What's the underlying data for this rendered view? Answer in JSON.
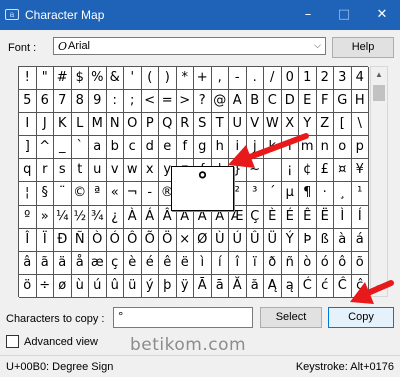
{
  "window": {
    "title": "Character Map",
    "app_icon": "character-map-icon",
    "minimize_glyph": "–",
    "maximize_glyph": "□",
    "close_glyph": "✕"
  },
  "font_row": {
    "label": "Font :",
    "selected_icon": "O",
    "selected_font": "Arial",
    "dropdown_glyph": "⌵",
    "help_label": "Help"
  },
  "grid": {
    "rows": [
      [
        "!",
        "\"",
        "#",
        "$",
        "%",
        "&",
        "'",
        "(",
        ")",
        "*",
        "+",
        ",",
        "-",
        ".",
        "/",
        "0",
        "1",
        "2",
        "3",
        "4"
      ],
      [
        "5",
        "6",
        "7",
        "8",
        "9",
        ":",
        ";",
        "<",
        "=",
        ">",
        "?",
        "@",
        "A",
        "B",
        "C",
        "D",
        "E",
        "F",
        "G",
        "H"
      ],
      [
        "I",
        "J",
        "K",
        "L",
        "M",
        "N",
        "O",
        "P",
        "Q",
        "R",
        "S",
        "T",
        "U",
        "V",
        "W",
        "X",
        "Y",
        "Z",
        "[",
        "\\"
      ],
      [
        "]",
        "^",
        "_",
        "`",
        "a",
        "b",
        "c",
        "d",
        "e",
        "f",
        "g",
        "h",
        "i",
        "j",
        "k",
        "l",
        "m",
        "n",
        "o",
        "p"
      ],
      [
        "q",
        "r",
        "s",
        "t",
        "u",
        "v",
        "w",
        "x",
        "y",
        "z",
        "{",
        "|",
        "}",
        "~",
        "",
        "¡",
        "¢",
        "£",
        "¤",
        "¥"
      ],
      [
        "¦",
        "§",
        "¨",
        "©",
        "ª",
        "«",
        "¬",
        "-",
        "®",
        "¯",
        "°",
        "±",
        "²",
        "³",
        "´",
        "µ",
        "¶",
        "·",
        "¸",
        "¹"
      ],
      [
        "º",
        "»",
        "¼",
        "½",
        "¾",
        "¿",
        "À",
        "Á",
        "Â",
        "Ã",
        "Ä",
        "Å",
        "Æ",
        "Ç",
        "È",
        "É",
        "Ê",
        "Ë",
        "Ì",
        "Í"
      ],
      [
        "Î",
        "Ï",
        "Ð",
        "Ñ",
        "Ò",
        "Ó",
        "Ô",
        "Õ",
        "Ö",
        "×",
        "Ø",
        "Ù",
        "Ú",
        "Û",
        "Ü",
        "Ý",
        "Þ",
        "ß",
        "à",
        "á"
      ],
      [
        "â",
        "ã",
        "ä",
        "å",
        "æ",
        "ç",
        "è",
        "é",
        "ê",
        "ë",
        "ì",
        "í",
        "î",
        "ï",
        "ð",
        "ñ",
        "ò",
        "ó",
        "ô",
        "õ"
      ],
      [
        "ö",
        "÷",
        "ø",
        "ù",
        "ú",
        "û",
        "ü",
        "ý",
        "þ",
        "ÿ",
        "Ā",
        "ā",
        "Ă",
        "ă",
        "Ą",
        "ą",
        "Ć",
        "ć",
        "Ĉ",
        "ĉ"
      ]
    ],
    "enlarged_character": "°"
  },
  "scrollbar": {
    "up_glyph": "▲",
    "down_glyph": "▼"
  },
  "copy_row": {
    "label": "Characters to copy :",
    "value": "°",
    "select_label": "Select",
    "copy_label": "Copy"
  },
  "advanced_view": {
    "label": "Advanced view",
    "checked": false
  },
  "watermark": "betikom.com",
  "status": {
    "character": "U+00B0: Degree Sign",
    "keystroke": "Keystroke: Alt+0176"
  },
  "colors": {
    "titlebar": "#1e63b8",
    "annotation_arrow": "#e8191b",
    "default_button_border": "#0078d7"
  },
  "annotations": [
    "red-arrow-to-enlarged-character",
    "red-arrow-to-copy-button"
  ]
}
